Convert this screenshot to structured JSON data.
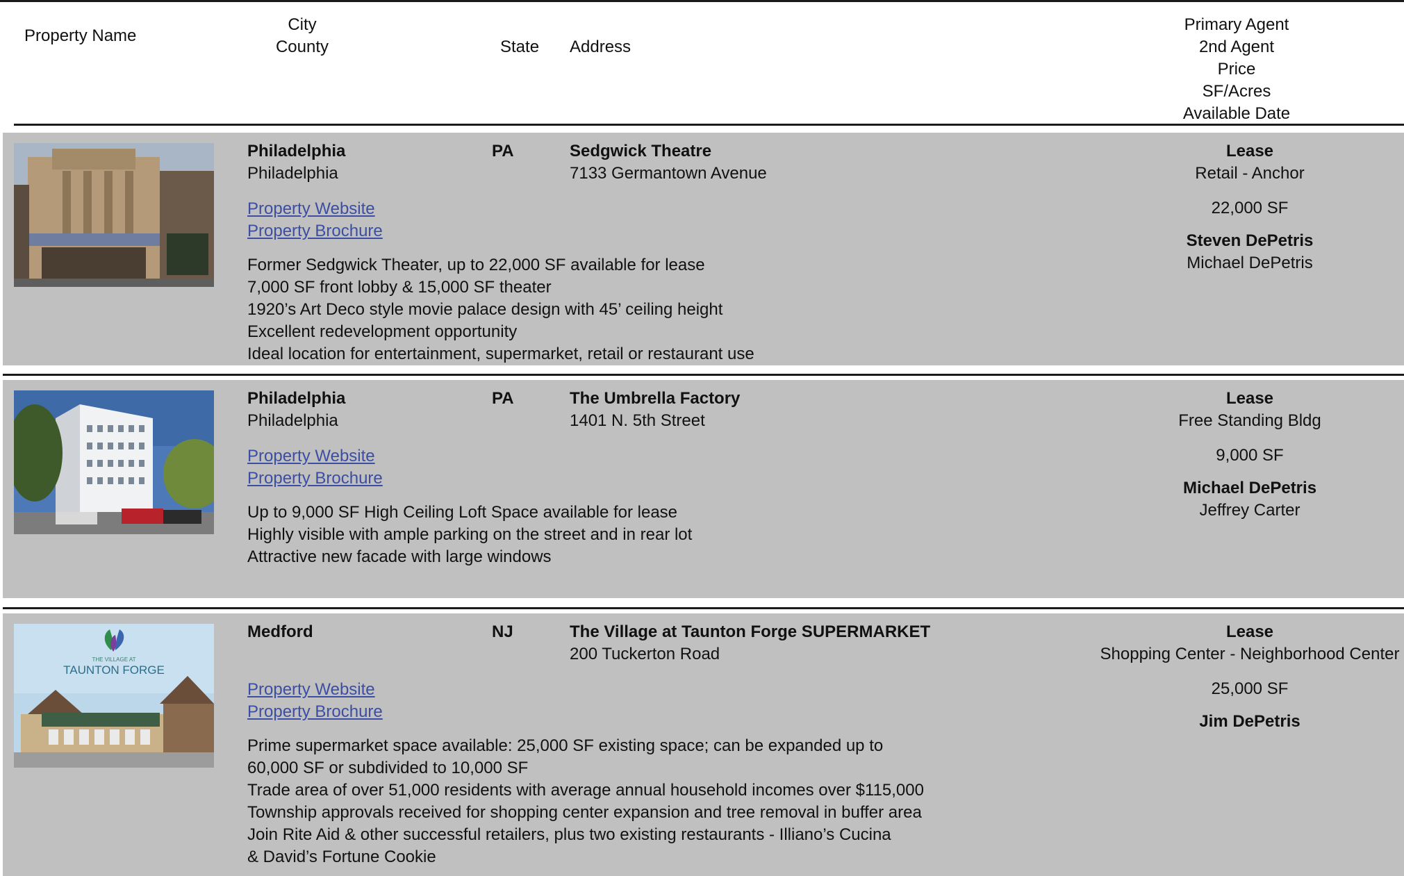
{
  "header": {
    "property_name": "Property Name",
    "city": "City",
    "county": "County",
    "state": "State",
    "address": "Address",
    "primary_agent": "Primary Agent",
    "second_agent": "2nd Agent",
    "price": "Price",
    "sf_acres": "SF/Acres",
    "available_date": "Available Date"
  },
  "listings": [
    {
      "photo_alt": "Sedgwick Theatre facade",
      "city": "Philadelphia",
      "county": "Philadelphia",
      "state": "PA",
      "name": "Sedgwick Theatre",
      "address": "7133 Germantown Avenue",
      "website_label": "Property Website",
      "brochure_label": "Property Brochure",
      "description": [
        "Former Sedgwick Theater, up to 22,000 SF available for lease",
        "7,000 SF front lobby & 15,000 SF theater",
        "1920’s Art Deco style movie palace design with 45’ ceiling height",
        "Excellent redevelopment opportunity",
        "Ideal location for entertainment, supermarket, retail or restaurant use"
      ],
      "deal_type": "Lease",
      "property_type": "Retail - Anchor",
      "size": "22,000 SF",
      "primary_agent": "Steven DePetris",
      "second_agent": "Michael DePetris"
    },
    {
      "photo_alt": "The Umbrella Factory building",
      "city": "Philadelphia",
      "county": "Philadelphia",
      "state": "PA",
      "name": "The Umbrella Factory",
      "address": "1401 N. 5th Street",
      "website_label": "Property Website",
      "brochure_label": "Property Brochure",
      "description": [
        "Up to 9,000 SF High Ceiling Loft Space available for lease",
        "Highly visible with ample parking on the street and in rear lot",
        "Attractive new facade with large windows"
      ],
      "deal_type": "Lease",
      "property_type": "Free Standing Bldg",
      "size": "9,000 SF",
      "primary_agent": "Michael DePetris",
      "second_agent": "Jeffrey Carter"
    },
    {
      "photo_alt": "The Village at Taunton Forge rendering",
      "photo_logo_small": "THE VILLAGE AT",
      "photo_logo_large": "TAUNTON FORGE",
      "city": "Medford",
      "county": "",
      "state": "NJ",
      "name": "The Village at Taunton Forge SUPERMARKET",
      "address": "200 Tuckerton Road",
      "website_label": "Property Website",
      "brochure_label": "Property Brochure",
      "description": [
        "Prime supermarket space available: 25,000 SF existing space; can be expanded up to",
        "60,000 SF or subdivided to 10,000 SF",
        "Trade area of over 51,000 residents with average annual household incomes over $115,000",
        "Township approvals received for shopping center expansion and tree removal in buffer area",
        "Join Rite Aid & other successful retailers, plus two existing restaurants - Illiano’s Cucina",
        "& David’s Fortune Cookie"
      ],
      "deal_type": "Lease",
      "property_type": "Shopping Center - Neighborhood Center",
      "size": "25,000 SF",
      "primary_agent": "Jim DePetris",
      "second_agent": ""
    }
  ]
}
